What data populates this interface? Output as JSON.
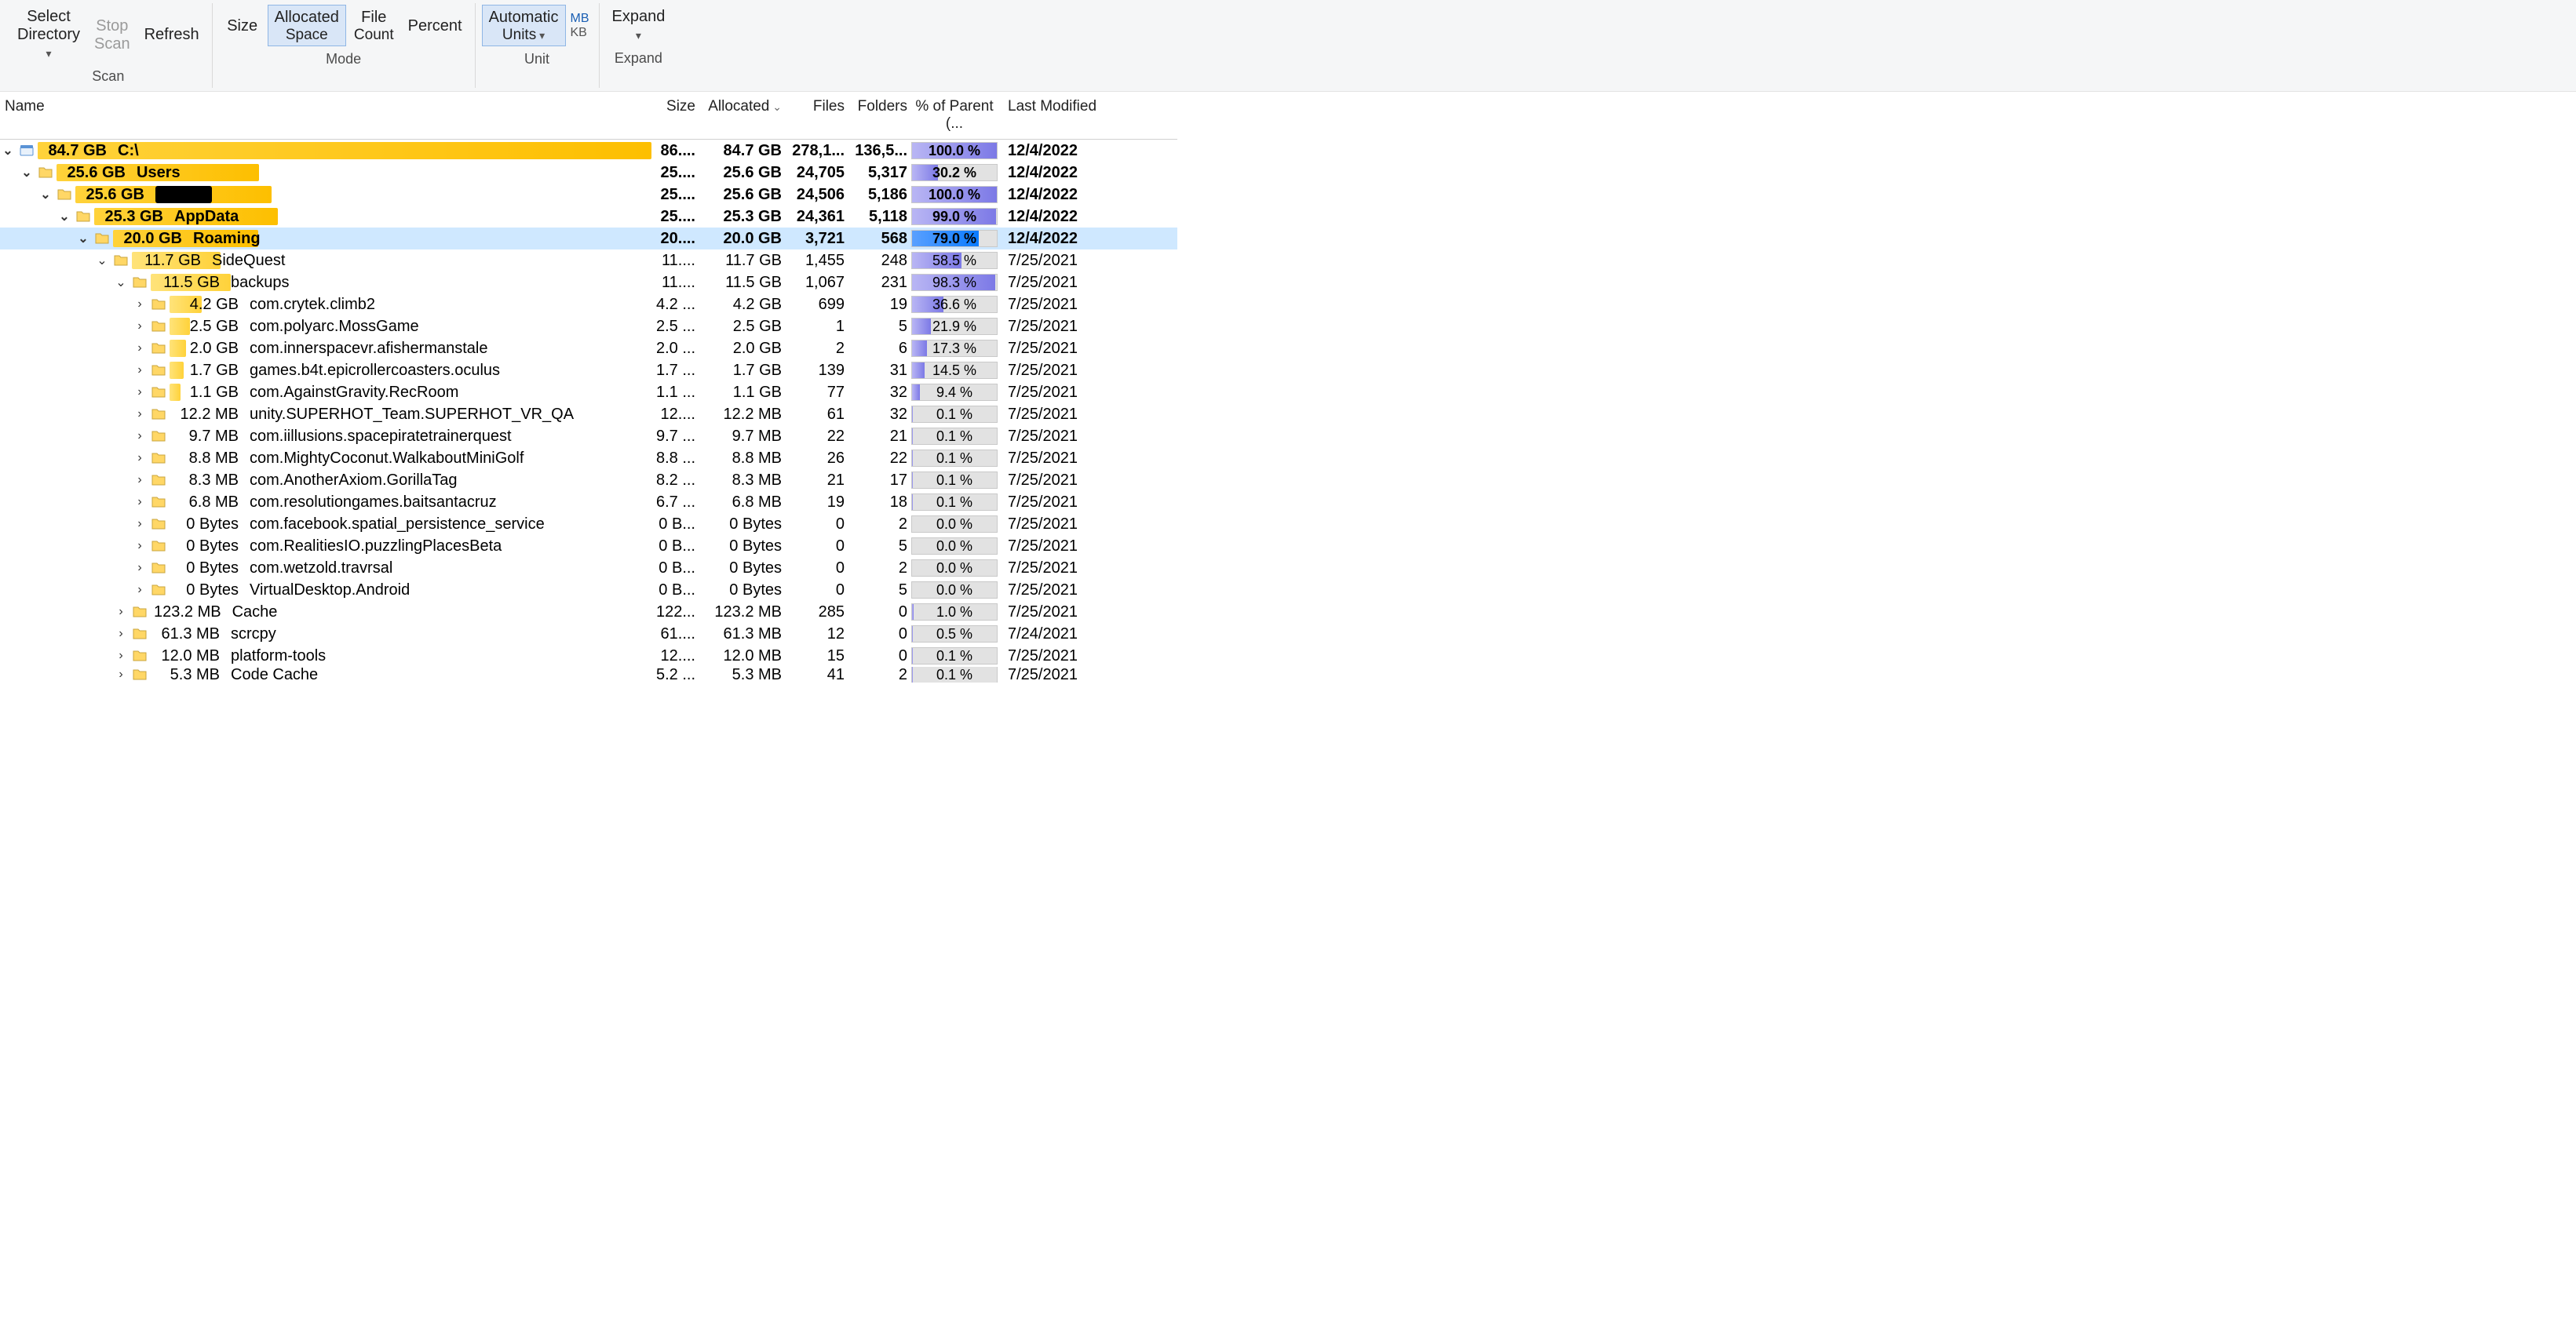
{
  "ribbon": {
    "scan": {
      "select_dir": "Select Directory",
      "stop_scan": "Stop Scan",
      "refresh": "Refresh",
      "label": "Scan"
    },
    "mode": {
      "size": "Size",
      "allocated": "Allocated",
      "space": "Space",
      "file": "File",
      "count": "Count",
      "percent": "Percent",
      "label": "Mode"
    },
    "unit": {
      "auto": "Automatic",
      "units": "Units",
      "mb": "MB",
      "kb": "KB",
      "label": "Unit"
    },
    "expand": {
      "expand": "Expand",
      "label": "Expand"
    }
  },
  "cols": {
    "name": "Name",
    "size": "Size",
    "allocated": "Allocated",
    "files": "Files",
    "folders": "Folders",
    "pct": "% of Parent (...",
    "modified": "Last Modified"
  },
  "rows": [
    {
      "level": 0,
      "tw": "v",
      "icon": "drive",
      "bold": true,
      "barPct": 100,
      "size": "84.7 GB",
      "name": "C:\\",
      "csize": "86....",
      "alloc": "84.7 GB",
      "files": "278,1...",
      "folders": "136,5...",
      "pct": "100.0 %",
      "pfill": 100,
      "mod": "12/4/2022"
    },
    {
      "level": 1,
      "tw": "v",
      "icon": "folder",
      "bold": true,
      "barPct": 34,
      "size": "25.6 GB",
      "name": "Users",
      "csize": "25....",
      "alloc": "25.6 GB",
      "files": "24,705",
      "folders": "5,317",
      "pct": "30.2 %",
      "pfill": 30.2,
      "mod": "12/4/2022"
    },
    {
      "level": 2,
      "tw": "v",
      "icon": "folder",
      "bold": true,
      "barPct": 34,
      "size": "25.6 GB",
      "name": "[REDACTED]",
      "redact": true,
      "csize": "25....",
      "alloc": "25.6 GB",
      "files": "24,506",
      "folders": "5,186",
      "pct": "100.0 %",
      "pfill": 100,
      "mod": "12/4/2022"
    },
    {
      "level": 3,
      "tw": "v",
      "icon": "folder",
      "bold": true,
      "barPct": 33,
      "size": "25.3 GB",
      "name": "AppData",
      "csize": "25....",
      "alloc": "25.3 GB",
      "files": "24,361",
      "folders": "5,118",
      "pct": "99.0 %",
      "pfill": 99,
      "mod": "12/4/2022"
    },
    {
      "level": 4,
      "tw": "v",
      "icon": "folder",
      "bold": true,
      "selected": true,
      "barPct": 27,
      "size": "20.0 GB",
      "name": "Roaming",
      "csize": "20....",
      "alloc": "20.0 GB",
      "files": "3,721",
      "folders": "568",
      "pct": "79.0 %",
      "pfill": 79,
      "mod": "12/4/2022"
    },
    {
      "level": 5,
      "tw": "v",
      "icon": "folder",
      "barPct": 17,
      "size": "11.7 GB",
      "name": "SideQuest",
      "csize": "11....",
      "alloc": "11.7 GB",
      "files": "1,455",
      "folders": "248",
      "pct": "58.5 %",
      "pfill": 58.5,
      "mod": "7/25/2021"
    },
    {
      "level": 6,
      "tw": "v",
      "icon": "folder",
      "barPct": 16,
      "size": "11.5 GB",
      "name": "backups",
      "csize": "11....",
      "alloc": "11.5 GB",
      "files": "1,067",
      "folders": "231",
      "pct": "98.3 %",
      "pfill": 98.3,
      "mod": "7/25/2021"
    },
    {
      "level": 7,
      "tw": ">",
      "icon": "folder",
      "barPct": 6.6,
      "size": "4.2 GB",
      "name": "com.crytek.climb2",
      "csize": "4.2 ...",
      "alloc": "4.2 GB",
      "files": "699",
      "folders": "19",
      "pct": "36.6 %",
      "pfill": 36.6,
      "mod": "7/25/2021"
    },
    {
      "level": 7,
      "tw": ">",
      "icon": "folder",
      "barPct": 4.2,
      "size": "2.5 GB",
      "name": "com.polyarc.MossGame",
      "csize": "2.5 ...",
      "alloc": "2.5 GB",
      "files": "1",
      "folders": "5",
      "pct": "21.9 %",
      "pfill": 21.9,
      "mod": "7/25/2021"
    },
    {
      "level": 7,
      "tw": ">",
      "icon": "folder",
      "barPct": 3.5,
      "size": "2.0 GB",
      "name": "com.innerspacevr.afishermanstale",
      "csize": "2.0 ...",
      "alloc": "2.0 GB",
      "files": "2",
      "folders": "6",
      "pct": "17.3 %",
      "pfill": 17.3,
      "mod": "7/25/2021"
    },
    {
      "level": 7,
      "tw": ">",
      "icon": "folder",
      "barPct": 3.0,
      "size": "1.7 GB",
      "name": "games.b4t.epicrollercoasters.oculus",
      "csize": "1.7 ...",
      "alloc": "1.7 GB",
      "files": "139",
      "folders": "31",
      "pct": "14.5 %",
      "pfill": 14.5,
      "mod": "7/25/2021"
    },
    {
      "level": 7,
      "tw": ">",
      "icon": "folder",
      "barPct": 2.2,
      "size": "1.1 GB",
      "name": "com.AgainstGravity.RecRoom",
      "csize": "1.1 ...",
      "alloc": "1.1 GB",
      "files": "77",
      "folders": "32",
      "pct": "9.4 %",
      "pfill": 9.4,
      "mod": "7/25/2021"
    },
    {
      "level": 7,
      "tw": ">",
      "icon": "folder",
      "barPct": 0,
      "size": "12.2 MB",
      "name": "unity.SUPERHOT_Team.SUPERHOT_VR_QA",
      "csize": "12....",
      "alloc": "12.2 MB",
      "files": "61",
      "folders": "32",
      "pct": "0.1 %",
      "pfill": 0.5,
      "mod": "7/25/2021"
    },
    {
      "level": 7,
      "tw": ">",
      "icon": "folder",
      "barPct": 0,
      "size": "9.7 MB",
      "name": "com.iillusions.spacepiratetrainerquest",
      "csize": "9.7 ...",
      "alloc": "9.7 MB",
      "files": "22",
      "folders": "21",
      "pct": "0.1 %",
      "pfill": 0.5,
      "mod": "7/25/2021"
    },
    {
      "level": 7,
      "tw": ">",
      "icon": "folder",
      "barPct": 0,
      "size": "8.8 MB",
      "name": "com.MightyCoconut.WalkaboutMiniGolf",
      "csize": "8.8 ...",
      "alloc": "8.8 MB",
      "files": "26",
      "folders": "22",
      "pct": "0.1 %",
      "pfill": 0.5,
      "mod": "7/25/2021"
    },
    {
      "level": 7,
      "tw": ">",
      "icon": "folder",
      "barPct": 0,
      "size": "8.3 MB",
      "name": "com.AnotherAxiom.GorillaTag",
      "csize": "8.2 ...",
      "alloc": "8.3 MB",
      "files": "21",
      "folders": "17",
      "pct": "0.1 %",
      "pfill": 0.5,
      "mod": "7/25/2021"
    },
    {
      "level": 7,
      "tw": ">",
      "icon": "folder",
      "barPct": 0,
      "size": "6.8 MB",
      "name": "com.resolutiongames.baitsantacruz",
      "csize": "6.7 ...",
      "alloc": "6.8 MB",
      "files": "19",
      "folders": "18",
      "pct": "0.1 %",
      "pfill": 0.5,
      "mod": "7/25/2021"
    },
    {
      "level": 7,
      "tw": ">",
      "icon": "folder",
      "barPct": 0,
      "size": "0 Bytes",
      "name": "com.facebook.spatial_persistence_service",
      "csize": "0 B...",
      "alloc": "0 Bytes",
      "files": "0",
      "folders": "2",
      "pct": "0.0 %",
      "pfill": 0,
      "mod": "7/25/2021"
    },
    {
      "level": 7,
      "tw": ">",
      "icon": "folder",
      "barPct": 0,
      "size": "0 Bytes",
      "name": "com.RealitiesIO.puzzlingPlacesBeta",
      "csize": "0 B...",
      "alloc": "0 Bytes",
      "files": "0",
      "folders": "5",
      "pct": "0.0 %",
      "pfill": 0,
      "mod": "7/25/2021"
    },
    {
      "level": 7,
      "tw": ">",
      "icon": "folder",
      "barPct": 0,
      "size": "0 Bytes",
      "name": "com.wetzold.travrsal",
      "csize": "0 B...",
      "alloc": "0 Bytes",
      "files": "0",
      "folders": "2",
      "pct": "0.0 %",
      "pfill": 0,
      "mod": "7/25/2021"
    },
    {
      "level": 7,
      "tw": ">",
      "icon": "folder",
      "barPct": 0,
      "size": "0 Bytes",
      "name": "VirtualDesktop.Android",
      "csize": "0 B...",
      "alloc": "0 Bytes",
      "files": "0",
      "folders": "5",
      "pct": "0.0 %",
      "pfill": 0,
      "mod": "7/25/2021"
    },
    {
      "level": 6,
      "tw": ">",
      "icon": "folder",
      "barPct": 0,
      "size": "123.2 MB",
      "name": "Cache",
      "csize": "122...",
      "alloc": "123.2 MB",
      "files": "285",
      "folders": "0",
      "pct": "1.0 %",
      "pfill": 1.5,
      "mod": "7/25/2021"
    },
    {
      "level": 6,
      "tw": ">",
      "icon": "folder",
      "barPct": 0,
      "size": "61.3 MB",
      "name": "scrcpy",
      "csize": "61....",
      "alloc": "61.3 MB",
      "files": "12",
      "folders": "0",
      "pct": "0.5 %",
      "pfill": 1,
      "mod": "7/24/2021"
    },
    {
      "level": 6,
      "tw": ">",
      "icon": "folder",
      "barPct": 0,
      "size": "12.0 MB",
      "name": "platform-tools",
      "csize": "12....",
      "alloc": "12.0 MB",
      "files": "15",
      "folders": "0",
      "pct": "0.1 %",
      "pfill": 0.5,
      "mod": "7/25/2021"
    },
    {
      "level": 6,
      "tw": ">",
      "icon": "folder",
      "barPct": 0,
      "size": "5.3 MB",
      "name": "Code Cache",
      "csize": "5.2 ...",
      "alloc": "5.3 MB",
      "files": "41",
      "folders": "2",
      "pct": "0.1 %",
      "pfill": 0.5,
      "mod": "7/25/2021",
      "cut": true
    }
  ]
}
